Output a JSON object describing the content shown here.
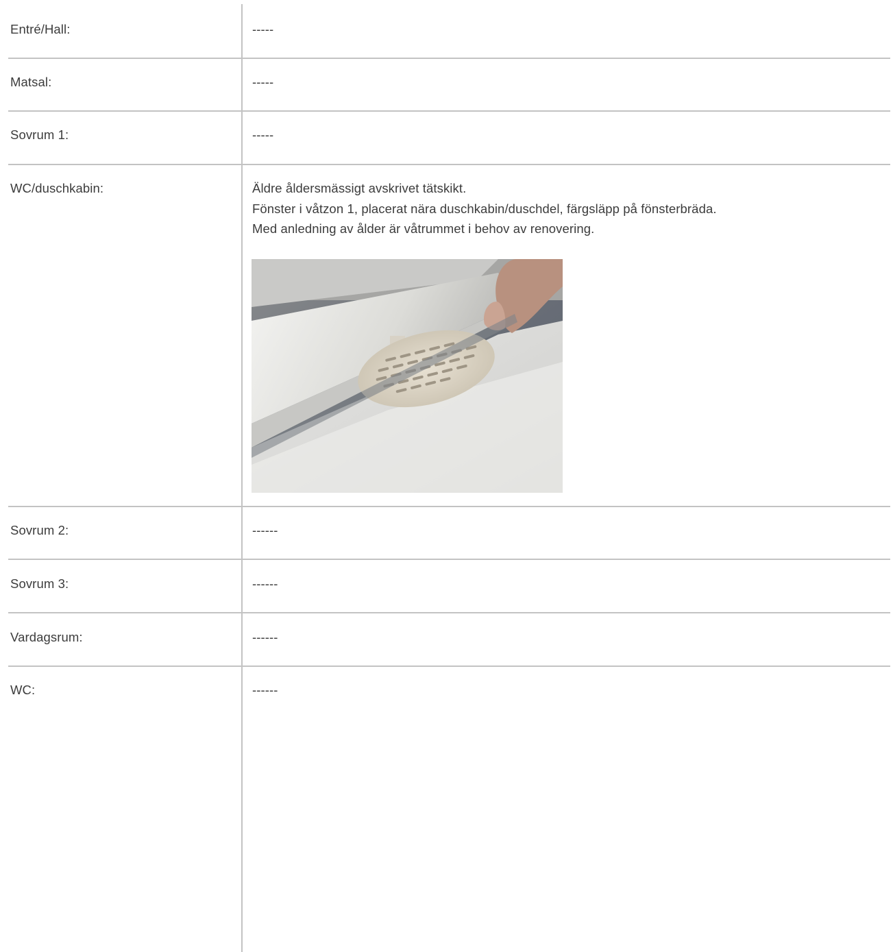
{
  "rooms": [
    {
      "label": "Entré/Hall:",
      "value": "-----"
    },
    {
      "label": "Matsal:",
      "value": "-----"
    },
    {
      "label": "Sovrum 1:",
      "value": "-----"
    },
    {
      "label": "WC/duschkabin:",
      "lines": [
        "Äldre åldersmässigt avskrivet tätskikt.",
        "Fönster i våtzon 1, placerat nära duschkabin/duschdel, färgsläpp på fönsterbräda.",
        "Med anledning av ålder är våtrummet i behov av renovering."
      ],
      "photo_icon": "shower-drain-photo"
    },
    {
      "label": "Sovrum 2:",
      "value": "------"
    },
    {
      "label": "Sovrum 3:",
      "value": "------"
    },
    {
      "label": "Vardagsrum:",
      "value": "------"
    },
    {
      "label": "WC:",
      "value": "------"
    }
  ]
}
